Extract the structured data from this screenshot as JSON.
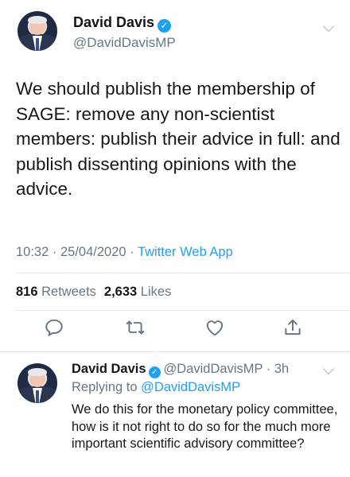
{
  "main_tweet": {
    "author": {
      "name": "David Davis",
      "handle": "@DavidDavisMP",
      "verified": true
    },
    "text": "We should publish the membership of SAGE: remove any non-scientist members: publish their advice in full: and publish dissenting opinions with the advice.",
    "time": "10:32",
    "date": "25/04/2020",
    "source": "Twitter Web App",
    "separator": " · ",
    "retweets": {
      "count": "816",
      "label": "Retweets"
    },
    "likes": {
      "count": "2,633",
      "label": "Likes"
    },
    "actions": [
      {
        "name": "reply-icon"
      },
      {
        "name": "retweet-icon"
      },
      {
        "name": "like-icon"
      },
      {
        "name": "share-icon"
      }
    ]
  },
  "reply_tweet": {
    "author": {
      "name": "David Davis",
      "handle": "@DavidDavisMP",
      "verified": true
    },
    "age": "3h",
    "dot": " · ",
    "replying_to_label": "Replying to",
    "replying_to_handle": "@DavidDavisMP",
    "text": "We do this for the monetary policy committee, how is it not right to do so for the much more important scientific advisory committee?"
  },
  "colors": {
    "accent": "#1da1f2",
    "text_primary": "#14171a",
    "text_secondary": "#657786",
    "icon": "#657786",
    "divider": "#e1e8ed"
  }
}
